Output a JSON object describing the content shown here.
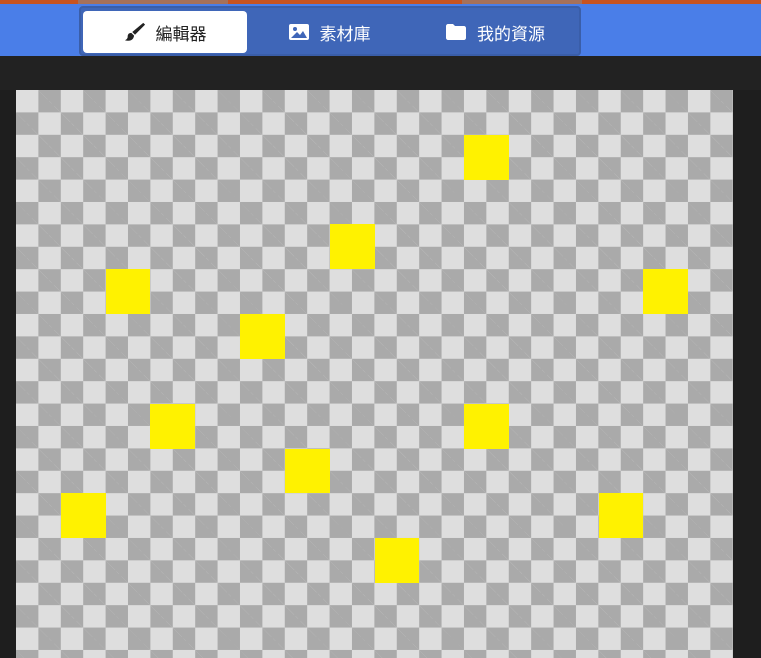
{
  "tabs": [
    {
      "label": "編輯器",
      "icon": "brush-icon",
      "active": true
    },
    {
      "label": "素材庫",
      "icon": "image-icon",
      "active": false
    },
    {
      "label": "我的資源",
      "icon": "folder-icon",
      "active": false
    }
  ],
  "colors": {
    "header": "#4a7ee8",
    "tab_group": "#3f66b8",
    "tile": "#fff200",
    "checker_light": "#dedede",
    "checker_dark": "#aaaaaa"
  },
  "canvas": {
    "grid_columns": 16,
    "tiles": [
      {
        "col": 10,
        "row": 1
      },
      {
        "col": 7,
        "row": 3
      },
      {
        "col": 2,
        "row": 4
      },
      {
        "col": 14,
        "row": 4
      },
      {
        "col": 5,
        "row": 5
      },
      {
        "col": 3,
        "row": 7
      },
      {
        "col": 10,
        "row": 7
      },
      {
        "col": 6,
        "row": 8
      },
      {
        "col": 1,
        "row": 9
      },
      {
        "col": 13,
        "row": 9
      },
      {
        "col": 8,
        "row": 10
      }
    ]
  }
}
